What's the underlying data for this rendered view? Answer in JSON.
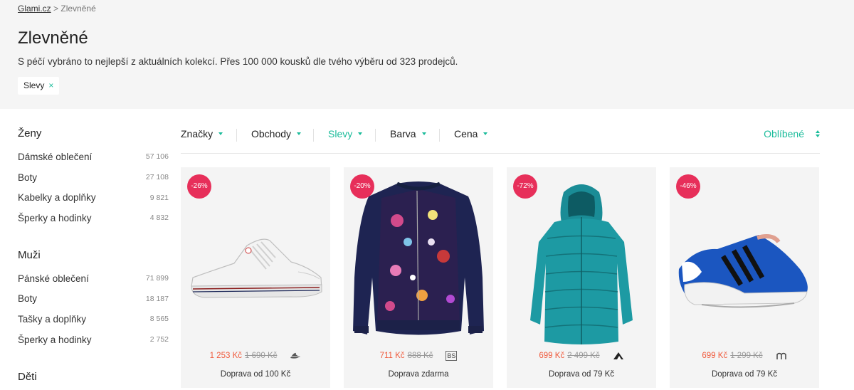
{
  "breadcrumb": {
    "home": "Glami.cz",
    "separator": ">",
    "current": "Zlevněné"
  },
  "title": "Zlevněné",
  "subtitle": "S péčí vybráno to nejlepší z aktuálních kolekcí. Přes 100 000 kousků dle tvého výběru od 323 prodejců.",
  "active_filter": {
    "label": "Slevy",
    "remove": "×"
  },
  "sidebar": {
    "women": {
      "heading": "Ženy",
      "items": [
        {
          "label": "Dámské oblečení",
          "count": "57 106"
        },
        {
          "label": "Boty",
          "count": "27 108"
        },
        {
          "label": "Kabelky a doplňky",
          "count": "9 821"
        },
        {
          "label": "Šperky a hodinky",
          "count": "4 832"
        }
      ]
    },
    "men": {
      "heading": "Muži",
      "items": [
        {
          "label": "Pánské oblečení",
          "count": "71 899"
        },
        {
          "label": "Boty",
          "count": "18 187"
        },
        {
          "label": "Tašky a doplňky",
          "count": "8 565"
        },
        {
          "label": "Šperky a hodinky",
          "count": "2 752"
        }
      ]
    },
    "kids": {
      "heading": "Děti"
    }
  },
  "filters": {
    "brands": "Značky",
    "shops": "Obchody",
    "discounts": "Slevy",
    "color": "Barva",
    "price": "Cena"
  },
  "sort": {
    "label": "Oblíbené"
  },
  "accent_color": "#1bbc9b",
  "badge_color": "#e72f5a",
  "price_color": "#f05a3c",
  "products": [
    {
      "discount": "-26%",
      "price": "1 253 Kč",
      "old_price": "1 690 Kč",
      "shipping": "Doprava od 100 Kč",
      "image": "white-sneaker",
      "shop_icon": "shoe-logo-icon"
    },
    {
      "discount": "-20%",
      "price": "711 Kč",
      "old_price": "888 Kč",
      "shipping": "Doprava zdarma",
      "image": "floral-bomber-jacket",
      "shop_icon": "bs-logo-icon",
      "shop_text": "BS"
    },
    {
      "discount": "-72%",
      "price": "699 Kč",
      "old_price": "2 499 Kč",
      "shipping": "Doprava od 79 Kč",
      "image": "teal-puffer-coat",
      "shop_icon": "mountain-logo-icon"
    },
    {
      "discount": "-46%",
      "price": "699 Kč",
      "old_price": "1 299 Kč",
      "shipping": "Doprava od 79 Kč",
      "image": "blue-running-shoe",
      "shop_icon": "m-logo-icon"
    }
  ]
}
